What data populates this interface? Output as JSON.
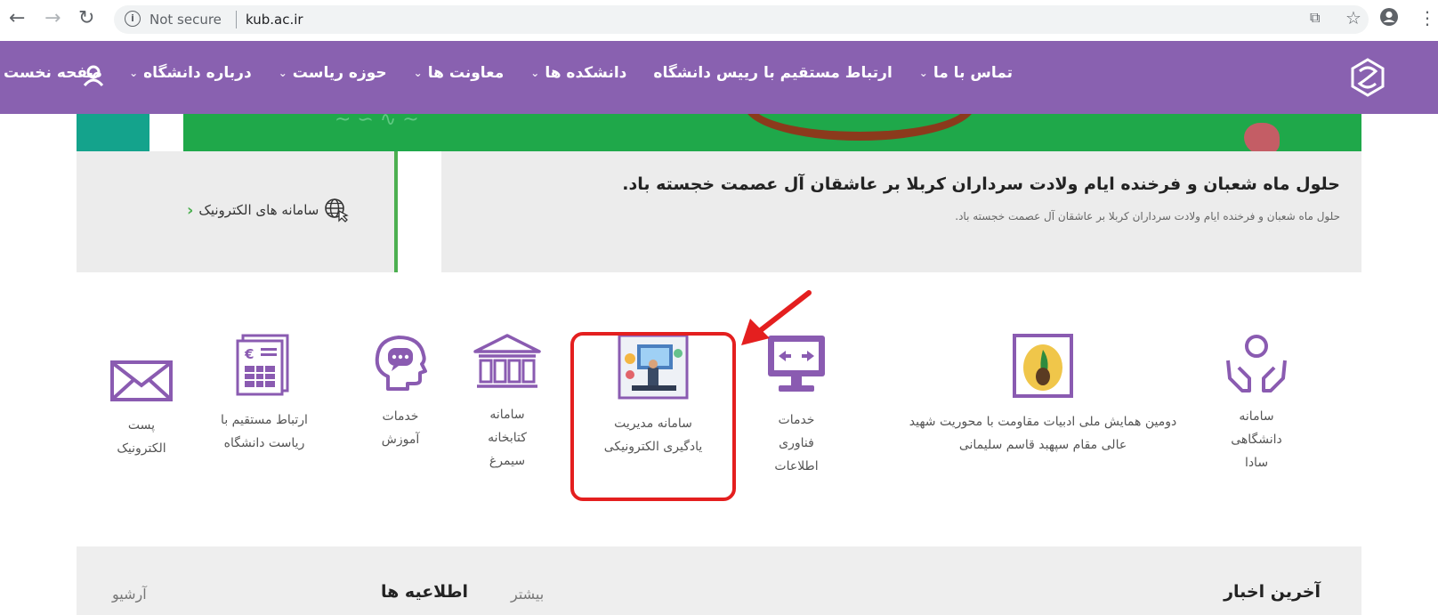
{
  "browser": {
    "security": "Not secure",
    "url": "kub.ac.ir"
  },
  "nav": {
    "items": [
      {
        "label": "صفحه نخست",
        "has_dropdown": false
      },
      {
        "label": "درباره دانشگاه",
        "has_dropdown": true
      },
      {
        "label": "حوزه ریاست",
        "has_dropdown": true
      },
      {
        "label": "معاونت ها",
        "has_dropdown": true
      },
      {
        "label": "دانشکده ها",
        "has_dropdown": true
      },
      {
        "label": "ارتباط مستقیم با رییس دانشگاه",
        "has_dropdown": false
      },
      {
        "label": "تماس با ما",
        "has_dropdown": true
      }
    ]
  },
  "announcement": {
    "title": "حلول ماه شعبان و فرخنده ایام ولادت سرداران کربلا بر عاشقان آل عصمت خجسته باد.",
    "subtitle": "حلول ماه شعبان و فرخنده ایام ولادت سرداران کربلا بر عاشقان آل عصمت خجسته باد.",
    "side_link": "سامانه های الکترونیک"
  },
  "services": [
    {
      "label": "سامانه\nدانشگاهی\nسادا",
      "icon": "hands-icon"
    },
    {
      "label": "دومین همایش ملی ادبیات مقاومت با محوریت شهید\nعالی مقام سپهبد قاسم سلیمانی",
      "icon": "conference-icon"
    },
    {
      "label": "خدمات\nفناوری\nاطلاعات",
      "icon": "monitor-icon"
    },
    {
      "label": "سامانه مدیریت\nیادگیری الکترونیکی",
      "icon": "elearning-icon"
    },
    {
      "label": "سامانه\nکتابخانه\nسیمرغ",
      "icon": "library-icon"
    },
    {
      "label": "خدمات\nآموزش",
      "icon": "head-chat-icon"
    },
    {
      "label": "ارتباط مستقیم با\nریاست دانشگاه",
      "icon": "document-icon"
    },
    {
      "label": "پست\nالکترونیک",
      "icon": "mail-icon"
    }
  ],
  "bottom": {
    "latest_news": "آخرین اخبار",
    "notices": "اطلاعیه ها",
    "more": "بیشتر",
    "archive": "آرشیو"
  },
  "colors": {
    "brand_purple": "#8055aa",
    "highlight_red": "#e41f1f",
    "accent_green": "#4caf50"
  }
}
